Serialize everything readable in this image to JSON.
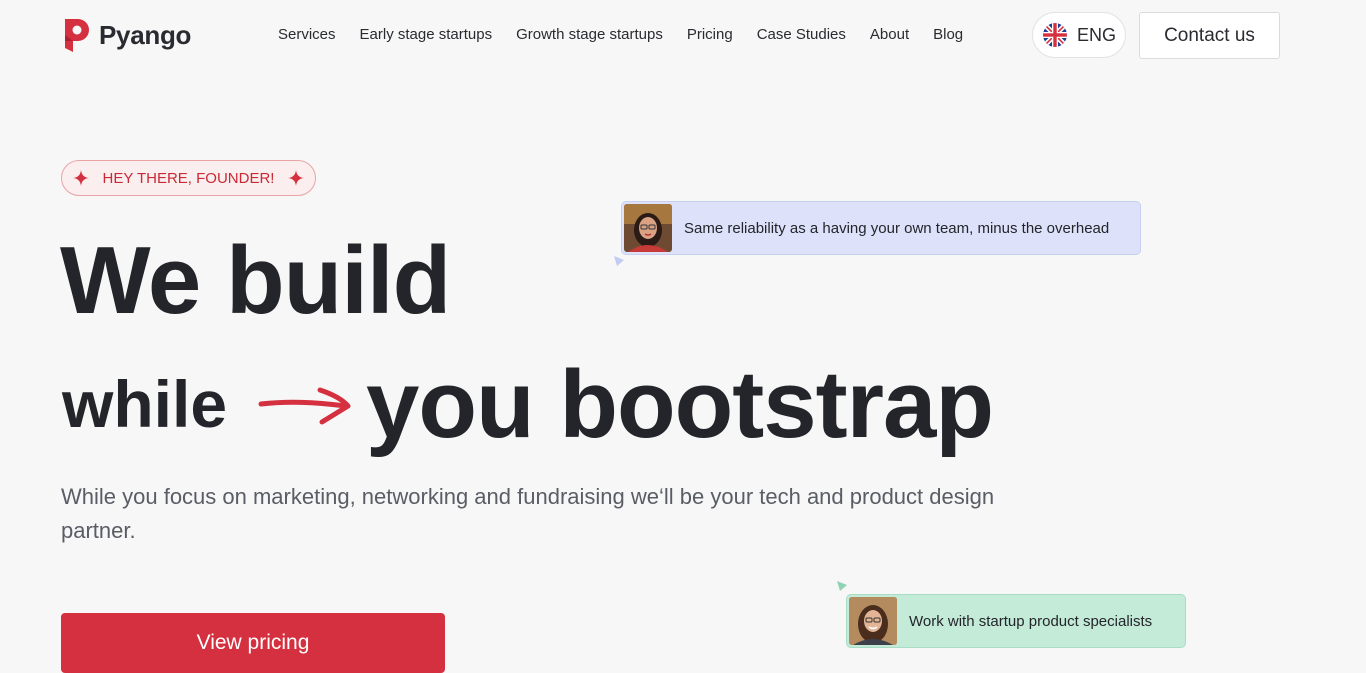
{
  "brand": {
    "name": "Pyango",
    "color": "#d5303f"
  },
  "nav": {
    "items": [
      {
        "label": "Services"
      },
      {
        "label": "Early stage startups"
      },
      {
        "label": "Growth stage startups"
      },
      {
        "label": "Pricing"
      },
      {
        "label": "Case Studies"
      },
      {
        "label": "About"
      },
      {
        "label": "Blog"
      }
    ]
  },
  "language": {
    "label": "ENG",
    "icon": "uk-flag-icon"
  },
  "contact": {
    "label": "Contact us"
  },
  "hero": {
    "badge": "HEY THERE, FOUNDER!",
    "headline_line1": "We build",
    "headline_word_small": "while",
    "headline_line2": "you bootstrap",
    "subtitle": "While you focus on marketing, networking and fundraising we‘ll be your tech and product design partner.",
    "cta": "View pricing"
  },
  "bubbles": [
    {
      "text": "Same reliability as a having your own team, minus the overhead",
      "color": "#dde2fa"
    },
    {
      "text": "Work with startup product specialists",
      "color": "#c3ebd8"
    }
  ]
}
